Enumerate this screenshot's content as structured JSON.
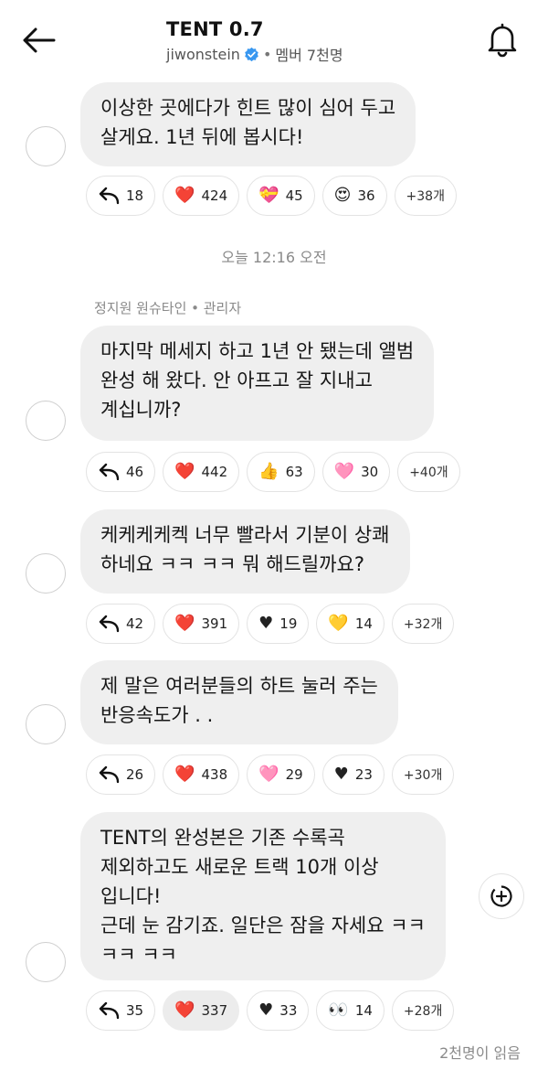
{
  "header": {
    "title": "TENT 0.7",
    "username": "jiwonstein",
    "separator": "•",
    "members": "멤버 7천명"
  },
  "messages": [
    {
      "text": "이상한 곳에다가 힌트 많이 심어 두고\n살게요. 1년 뒤에 봅시다!",
      "reactions": [
        {
          "icon": "reply-icon",
          "count": "18"
        },
        {
          "icon": "red-heart-emoji",
          "emoji": "❤️",
          "count": "424"
        },
        {
          "icon": "heart-with-ribbon-emoji",
          "emoji": "💝",
          "count": "45"
        },
        {
          "icon": "heart-eyes-emoji",
          "emoji": "😍",
          "count": "36"
        },
        {
          "icon": "more",
          "count": "+38개"
        }
      ]
    },
    {
      "text": "마지막 메세지 하고 1년 안 됐는데 앨범\n완성 해 왔다. 안 아프고 잘 지내고\n계십니까?",
      "reactions": [
        {
          "icon": "reply-icon",
          "count": "46"
        },
        {
          "icon": "red-heart-emoji",
          "emoji": "❤️",
          "count": "442"
        },
        {
          "icon": "thumbs-up-emoji",
          "emoji": "👍",
          "count": "63"
        },
        {
          "icon": "pink-heart-emoji",
          "emoji": "🩷",
          "count": "30"
        },
        {
          "icon": "more",
          "count": "+40개"
        }
      ]
    },
    {
      "text": "케케케케켁 너무 빨라서 기분이 상쾌\n하네요 ㅋㅋ ㅋㅋ 뭐 해드릴까요?",
      "reactions": [
        {
          "icon": "reply-icon",
          "count": "42"
        },
        {
          "icon": "red-heart-emoji",
          "emoji": "❤️",
          "count": "391"
        },
        {
          "icon": "black-heart-emoji",
          "emoji": "♥",
          "count": "19"
        },
        {
          "icon": "yellow-heart-emoji",
          "emoji": "💛",
          "count": "14"
        },
        {
          "icon": "more",
          "count": "+32개"
        }
      ]
    },
    {
      "text": "제 말은 여러분들의 하트 눌러 주는\n반응속도가 . .",
      "reactions": [
        {
          "icon": "reply-icon",
          "count": "26"
        },
        {
          "icon": "red-heart-emoji",
          "emoji": "❤️",
          "count": "438"
        },
        {
          "icon": "pink-heart-emoji",
          "emoji": "🩷",
          "count": "29"
        },
        {
          "icon": "black-heart-emoji",
          "emoji": "♥",
          "count": "23"
        },
        {
          "icon": "more",
          "count": "+30개"
        }
      ]
    },
    {
      "text": "TENT의 완성본은 기존 수록곡\n제외하고도 새로운 트랙 10개 이상\n입니다!\n근데 눈 감기죠. 일단은 잠을 자세요 ㅋㅋ\nㅋㅋ ㅋㅋ",
      "reactions": [
        {
          "icon": "reply-icon",
          "count": "35"
        },
        {
          "icon": "red-heart-emoji",
          "emoji": "❤️",
          "count": "337"
        },
        {
          "icon": "black-heart-emoji",
          "emoji": "♥",
          "count": "33"
        },
        {
          "icon": "eyes-emoji",
          "emoji": "👀",
          "count": "14"
        },
        {
          "icon": "more",
          "count": "+28개"
        }
      ]
    }
  ],
  "timestamp": "오늘 12:16 오전",
  "sender": "정지원 원슈타인 • 관리자",
  "read_receipt": "2천명이 읽음",
  "colors": {
    "bubble": "#efefef",
    "verified": "#3897f0",
    "muted_text": "#8a8a8a"
  }
}
